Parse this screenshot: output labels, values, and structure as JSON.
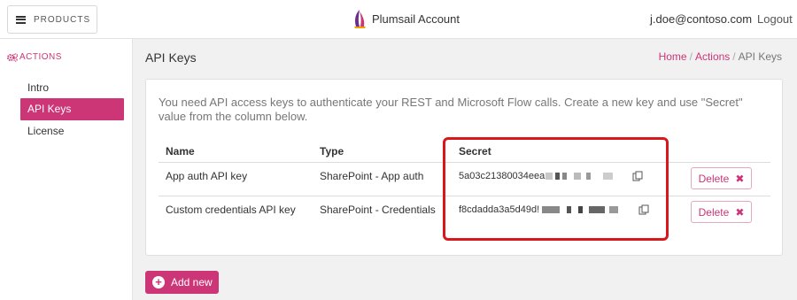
{
  "header": {
    "products_label": "PRODUCTS",
    "brand_name": "Plumsail Account",
    "user_email": "j.doe@contoso.com",
    "logout_label": "Logout"
  },
  "sidebar": {
    "section_title": "ACTIONS",
    "items": [
      {
        "label": "Intro",
        "active": false
      },
      {
        "label": "API Keys",
        "active": true
      },
      {
        "label": "License",
        "active": false
      }
    ]
  },
  "page": {
    "title": "API Keys",
    "breadcrumb": [
      "Home",
      "Actions",
      "API Keys"
    ]
  },
  "panel": {
    "intro_text": "You need API access keys to authenticate your REST and Microsoft Flow calls. Create a new key and use \"Secret\" value from the column below.",
    "columns": [
      "Name",
      "Type",
      "Secret"
    ],
    "rows": [
      {
        "name": "App auth API key",
        "type": "SharePoint - App auth",
        "secret": "5a03c21380034eea",
        "delete_label": "Delete"
      },
      {
        "name": "Custom credentials API key",
        "type": "SharePoint - Credentials",
        "secret": "f8cdadda3a5d49d!",
        "delete_label": "Delete"
      }
    ]
  },
  "add_button_label": "Add new",
  "colors": {
    "accent": "#cc3576",
    "highlight_border": "#d8181b"
  },
  "icons": {
    "menu": "hamburger-icon",
    "brand": "plumsail-logo",
    "section": "gears-icon",
    "copy": "copy-icon",
    "delete": "close-icon",
    "add": "plus-circle-icon"
  }
}
